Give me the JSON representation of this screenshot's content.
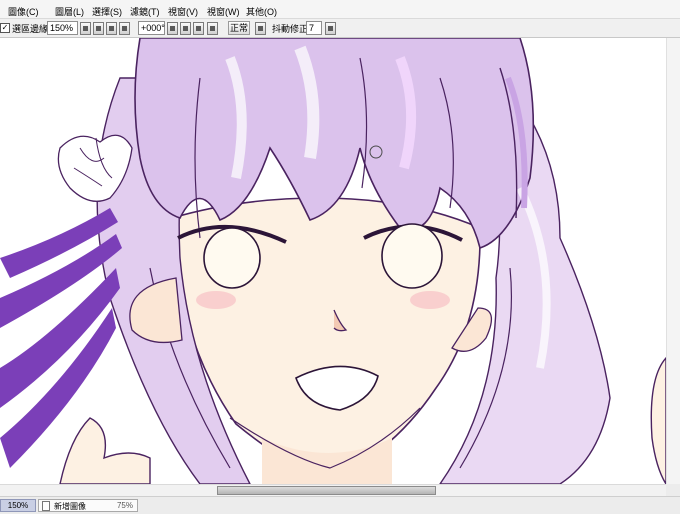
{
  "menubar": {
    "items": [
      "圖像(C)",
      "圖層(L)",
      "選擇(S)",
      "濾鏡(T)",
      "視窗(V)",
      "視窗(W)",
      "其他(O)"
    ]
  },
  "toolbar": {
    "antialias_checked": "✓",
    "antialias_label": "選區邊緣",
    "zoom_value": "150%",
    "rotation_value": "+000°",
    "blend_mode": "正常",
    "stabilizer_label": "抖動修正",
    "stabilizer_value": "7"
  },
  "statusbar": {
    "zoom": "150%",
    "canvas_name": "新增圖像",
    "canvas_zoom": "75%"
  },
  "colors": {
    "hair_purple": "#d9bfe8",
    "ribbon_purple": "#7b3fb8",
    "line_art": "#4a2360",
    "skin": "#fdeee0"
  }
}
